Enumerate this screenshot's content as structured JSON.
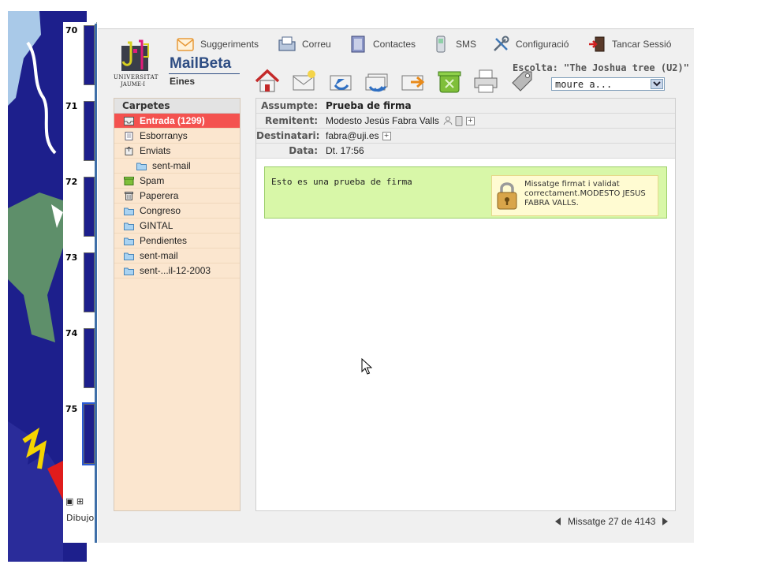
{
  "strip": {
    "slides": [
      "70",
      "71",
      "72",
      "73",
      "74",
      "75"
    ],
    "bottom_label": "Dibujo"
  },
  "logo": {
    "line1": "UNIVERSITAT",
    "line2": "JAUME·I"
  },
  "app": {
    "title": "MailBeta",
    "tools_label": "Eines"
  },
  "nav": [
    {
      "label": "Suggeriments",
      "icon": "envelope-suggest-icon"
    },
    {
      "label": "Correu",
      "icon": "folder-mail-icon"
    },
    {
      "label": "Contactes",
      "icon": "address-book-icon"
    },
    {
      "label": "SMS",
      "icon": "mobile-phone-icon"
    },
    {
      "label": "Configuració",
      "icon": "tools-icon"
    },
    {
      "label": "Tancar Sessió",
      "icon": "logout-door-icon"
    }
  ],
  "toolbar": {
    "buttons": [
      "home-icon",
      "compose-icon",
      "reply-icon",
      "reply-all-icon",
      "forward-icon",
      "delete-icon",
      "print-icon",
      "tag-icon"
    ],
    "listen_label": "Escolta: \"The Joshua tree (U2)\"",
    "move_value": "moure a..."
  },
  "folders": {
    "header": "Carpetes",
    "items": [
      {
        "label": "Entrada (1299)",
        "icon": "inbox-icon",
        "selected": true
      },
      {
        "label": "Esborranys",
        "icon": "drafts-icon"
      },
      {
        "label": "Enviats",
        "icon": "sent-icon"
      },
      {
        "label": "sent-mail",
        "icon": "folder-icon",
        "sub": true
      },
      {
        "label": "Spam",
        "icon": "spam-icon"
      },
      {
        "label": "Paperera",
        "icon": "trash-icon"
      },
      {
        "label": "Congreso",
        "icon": "folder-icon"
      },
      {
        "label": "GINTAL",
        "icon": "folder-icon"
      },
      {
        "label": "Pendientes",
        "icon": "folder-icon"
      },
      {
        "label": "sent-mail",
        "icon": "folder-icon"
      },
      {
        "label": "sent-...il-12-2003",
        "icon": "folder-icon"
      }
    ]
  },
  "message": {
    "subject_label": "Assumpte:",
    "subject": "Prueba de firma",
    "from_label": "Remitent:",
    "from": "Modesto Jesús Fabra Valls",
    "to_label": "Destinatari:",
    "to": "fabra@uji.es",
    "date_label": "Data:",
    "date": "Dt. 17:56",
    "body": "Esto es una prueba de firma",
    "signature": "Missatge firmat i validat correctament.MODESTO JESUS FABRA VALLS."
  },
  "pager": {
    "text": "Missatge 27 de 4143"
  },
  "colors": {
    "accent": "#2e4d83",
    "selected_folder": "#f4524f",
    "folder_bg": "#fbe6cf",
    "body_bg": "#d8f7a8"
  }
}
